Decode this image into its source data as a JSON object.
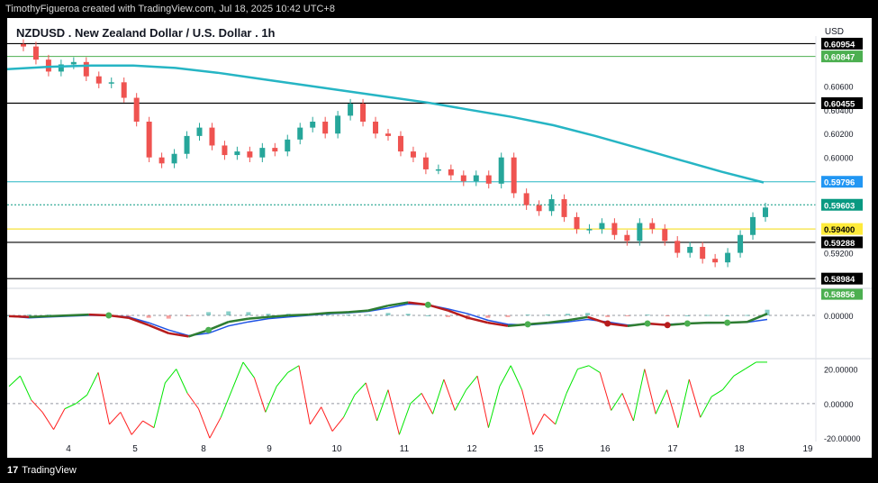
{
  "caption": "TimothyFigueroa created with TradingView.com, Jul 18, 2025 10:42 UTC+8",
  "title": "NZDUSD . New Zealand Dollar / U.S. Dollar . 1h",
  "currency": "USD",
  "footer_brand": "TradingView",
  "footer_mark": "17",
  "colors": {
    "up": "#26a69a",
    "down": "#ef5350",
    "ma": "#26b5c4",
    "macd_fast": "#2e7d32",
    "macd_slow": "#1e53e5",
    "rsi_up": "#00e600",
    "rsi_down": "#ff1e1e"
  },
  "chart_data": [
    {
      "type": "candlestick",
      "symbol": "NZDUSD",
      "timeframe": "1h",
      "x": [
        "4",
        "5",
        "8",
        "9",
        "10",
        "11",
        "12",
        "15",
        "16",
        "17",
        "18",
        "19"
      ],
      "ylim": [
        0.5894,
        0.6098
      ],
      "y_ticks": [
        "0.60600",
        "0.60400",
        "0.60200",
        "0.60000",
        "0.59200"
      ],
      "close_path": [
        0.6095,
        0.6093,
        0.6082,
        0.6072,
        0.6078,
        0.608,
        0.6068,
        0.6062,
        0.6063,
        0.605,
        0.603,
        0.6,
        0.5995,
        0.6003,
        0.6018,
        0.6025,
        0.601,
        0.6002,
        0.6005,
        0.6,
        0.6008,
        0.6005,
        0.6015,
        0.6025,
        0.603,
        0.602,
        0.6035,
        0.6045,
        0.603,
        0.602,
        0.6018,
        0.6005,
        0.6,
        0.599,
        0.599,
        0.5985,
        0.598,
        0.5985,
        0.5978,
        0.6,
        0.597,
        0.596,
        0.5955,
        0.5965,
        0.595,
        0.594,
        0.594,
        0.5945,
        0.5935,
        0.593,
        0.5945,
        0.594,
        0.593,
        0.592,
        0.5925,
        0.5915,
        0.5912,
        0.592,
        0.5935,
        0.595,
        0.5958
      ],
      "moving_average": [
        0.6074,
        0.6076,
        0.6077,
        0.6077,
        0.6075,
        0.6071,
        0.6066,
        0.6061,
        0.6056,
        0.6051,
        0.6046,
        0.604,
        0.6034,
        0.6027,
        0.6018,
        0.6008,
        0.5998,
        0.5988,
        0.5979
      ],
      "price_labels": [
        {
          "value": "0.60954",
          "bg": "#000000",
          "fg": "#ffffff"
        },
        {
          "value": "0.60847",
          "bg": "#4caf50",
          "fg": "#ffffff"
        },
        {
          "value": "0.60455",
          "bg": "#000000",
          "fg": "#ffffff"
        },
        {
          "value": "0.59796",
          "bg": "#2196f3",
          "fg": "#ffffff"
        },
        {
          "value": "0.59603",
          "bg": "#089981",
          "fg": "#ffffff"
        },
        {
          "value": "0.59400",
          "bg": "#ffeb3b",
          "fg": "#000000"
        },
        {
          "value": "0.59288",
          "bg": "#000000",
          "fg": "#ffffff"
        },
        {
          "value": "0.58984",
          "bg": "#000000",
          "fg": "#ffffff"
        },
        {
          "value": "0.58856",
          "bg": "#4caf50",
          "fg": "#ffffff"
        }
      ]
    },
    {
      "type": "line",
      "name": "MACD",
      "ylabel_tick": "0.00000",
      "macd": [
        -0.1,
        -0.2,
        -0.1,
        0.0,
        0.1,
        0.0,
        -0.3,
        -1.2,
        -2.2,
        -2.6,
        -1.8,
        -0.8,
        -0.4,
        -0.2,
        0.0,
        0.1,
        0.3,
        0.4,
        0.6,
        1.2,
        1.6,
        1.3,
        0.6,
        -0.3,
        -0.9,
        -1.3,
        -1.1,
        -0.9,
        -0.6,
        -0.2,
        -1.0,
        -1.3,
        -1.0,
        -1.2,
        -1.0,
        -0.9,
        -0.9,
        -0.8,
        0.2
      ],
      "signal": [
        -0.1,
        -0.3,
        -0.2,
        -0.1,
        0.0,
        0.0,
        -0.2,
        -0.9,
        -1.8,
        -2.5,
        -2.2,
        -1.3,
        -0.8,
        -0.4,
        -0.2,
        0.0,
        0.2,
        0.3,
        0.5,
        0.9,
        1.4,
        1.3,
        0.8,
        0.2,
        -0.6,
        -1.1,
        -1.2,
        -1.0,
        -0.8,
        -0.5,
        -0.8,
        -1.2,
        -1.1,
        -1.1,
        -1.0,
        -0.95,
        -0.9,
        -0.85,
        -0.5
      ],
      "histogram": [
        0.0,
        0.1,
        0.1,
        0.1,
        0.1,
        0.0,
        -0.1,
        -0.3,
        -0.4,
        -0.1,
        0.4,
        0.5,
        0.4,
        0.2,
        0.2,
        0.1,
        0.1,
        0.1,
        0.1,
        0.3,
        0.2,
        0.0,
        -0.2,
        -0.5,
        -0.3,
        -0.2,
        0.1,
        0.1,
        0.2,
        0.3,
        -0.2,
        -0.1,
        0.1,
        -0.1,
        0.0,
        0.05,
        0.0,
        0.05,
        0.7
      ]
    },
    {
      "type": "line",
      "name": "RSI-style oscillator",
      "y_ticks": [
        "20.00000",
        "0.00000",
        "-20.00000"
      ],
      "ylim": [
        -22,
        25
      ],
      "values": [
        10,
        16,
        2,
        -5,
        -15,
        -3,
        0,
        5,
        18,
        -12,
        -5,
        -18,
        -10,
        -14,
        12,
        20,
        6,
        -3,
        -20,
        -8,
        8,
        24,
        15,
        -5,
        10,
        18,
        22,
        -12,
        -2,
        -16,
        -8,
        5,
        12,
        -10,
        8,
        -18,
        0,
        6,
        -6,
        14,
        -4,
        8,
        16,
        -14,
        10,
        22,
        8,
        -18,
        -6,
        -12,
        6,
        20,
        22,
        18,
        -4,
        6,
        -10,
        20,
        -6,
        8,
        -14,
        14,
        -8,
        4,
        8,
        16,
        20,
        24,
        24
      ]
    }
  ]
}
